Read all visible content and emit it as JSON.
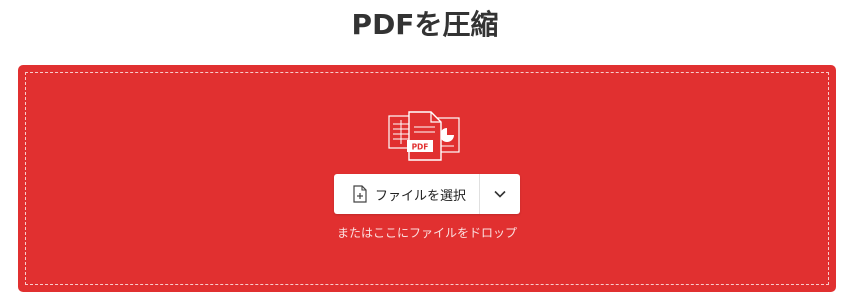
{
  "page": {
    "title": "PDFを圧縮"
  },
  "dropzone": {
    "select_button_label": "ファイルを選択",
    "drop_hint": "またはここにファイルをドロップ",
    "graphic_badge": "PDF",
    "icons": {
      "file_stack": "file-stack-icon",
      "file_add": "file-add-icon",
      "chevron": "chevron-down-icon"
    }
  },
  "colors": {
    "accent": "#e13030",
    "title_text": "#333333"
  }
}
